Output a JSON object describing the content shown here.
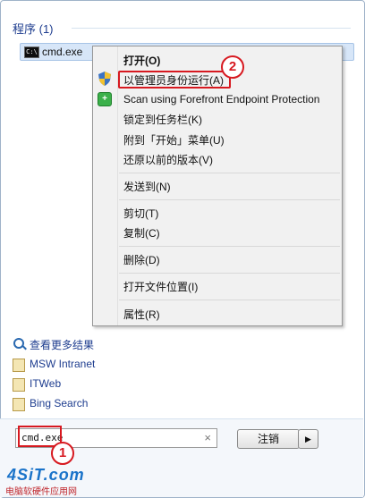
{
  "programs_group": {
    "title": "程序 (1)"
  },
  "result": {
    "icon": "cmd-icon",
    "icon_text": "C:\\",
    "label": "cmd.exe"
  },
  "context_menu": {
    "items": [
      {
        "label": "打开(O)",
        "bold": true
      },
      {
        "label": "以管理员身份运行(A)",
        "icon": "uac-shield-icon"
      },
      {
        "label": "Scan using Forefront Endpoint Protection",
        "icon": "forefront-icon"
      },
      {
        "label": "锁定到任务栏(K)"
      },
      {
        "label": "附到「开始」菜单(U)"
      },
      {
        "label": "还原以前的版本(V)"
      },
      {
        "label": "发送到(N)"
      },
      {
        "label": "剪切(T)"
      },
      {
        "label": "复制(C)"
      },
      {
        "label": "删除(D)"
      },
      {
        "label": "打开文件位置(I)"
      },
      {
        "label": "属性(R)"
      }
    ]
  },
  "links": [
    {
      "label": "查看更多结果",
      "icon": "magnifier-icon"
    },
    {
      "label": "MSW Intranet",
      "icon": "search-provider-icon"
    },
    {
      "label": "ITWeb",
      "icon": "search-provider-icon"
    },
    {
      "label": "Bing Search",
      "icon": "search-provider-icon"
    }
  ],
  "search": {
    "value": "cmd.exe",
    "clear_symbol": "×"
  },
  "cancel_button": {
    "label": "注销",
    "arrow": "▶"
  },
  "annotations": {
    "step1": "1",
    "step2": "2"
  },
  "watermark": {
    "logo": "4SiT.com",
    "subtitle": "电脑软硬件应用网"
  },
  "colors": {
    "highlight_red": "#d71920",
    "link_blue": "#1e3d8f",
    "selection_blue": "#d7e6f8"
  }
}
